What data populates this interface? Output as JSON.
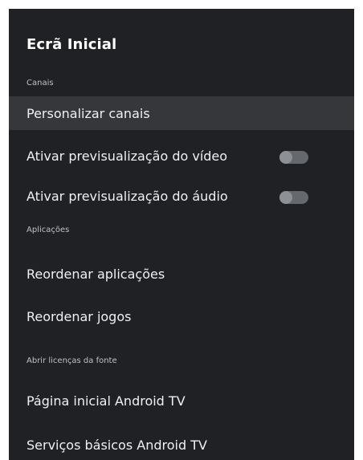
{
  "header": {
    "title": "Ecrã Inicial"
  },
  "sections": {
    "channels": "Canais",
    "apps": "Aplicações",
    "licenses": "Abrir licenças da fonte"
  },
  "items": {
    "customize_channels": "Personalizar canais",
    "video_preview": "Ativar previsualização do vídeo",
    "audio_preview": "Ativar previsualização do áudio",
    "reorder_apps": "Reordenar aplicações",
    "reorder_games": "Reordenar jogos",
    "android_tv_home": "Página inicial Android TV",
    "android_tv_core": "Serviços básicos Android TV"
  },
  "toggles": {
    "video_preview_on": false,
    "audio_preview_on": false
  },
  "colors": {
    "background": "#202124",
    "highlight": "#35373b",
    "toggle_track": "#65686d",
    "toggle_knob": "#8d9095"
  }
}
